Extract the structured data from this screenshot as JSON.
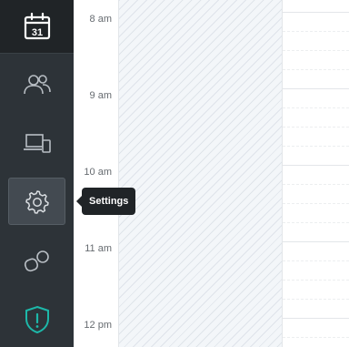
{
  "sidebar": {
    "items": [
      {
        "name": "calendar",
        "icon": "calendar-icon",
        "label": "31"
      },
      {
        "name": "people",
        "icon": "people-icon"
      },
      {
        "name": "devices",
        "icon": "devices-icon"
      },
      {
        "name": "settings",
        "icon": "gear-icon"
      },
      {
        "name": "apps",
        "icon": "apps-icon"
      },
      {
        "name": "security",
        "icon": "shield-alert-icon"
      }
    ]
  },
  "tooltip": {
    "text": "Settings"
  },
  "calendar": {
    "times": [
      "8 am",
      "9 am",
      "10 am",
      "11 am",
      "12 pm"
    ]
  },
  "colors": {
    "sidebar_bg": "#2d3338",
    "accent_teal": "#1db8a9",
    "icon_color": "#b8bec4"
  }
}
